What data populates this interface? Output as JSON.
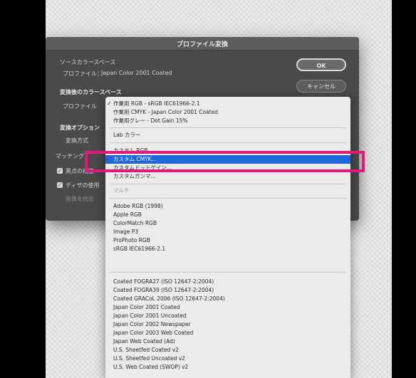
{
  "dialog": {
    "title": "プロファイル変換",
    "source_heading": "ソースカラースペース",
    "source_profile_label": "プロファイル：",
    "source_profile_value": "Japan Color 2001 Coated",
    "dest_heading": "変換後のカラースペース",
    "dest_profile_label": "プロファイル",
    "options_label": "変換オプション",
    "engine_label": "変換方式",
    "matching_label": "マッチング",
    "checkbox1_label": "黒点の補正",
    "checkbox2_label": "ディザの使用",
    "flatten_label": "画像を統合",
    "ok_label": "OK",
    "cancel_label": "キャンセル"
  },
  "dropdown": {
    "top_items": [
      "作業用 RGB - sRGB IEC61966-2.1",
      "作業用 CMYK - Japan Color 2001 Coated",
      "作業用グレー - Dot Gain 15%"
    ],
    "lab_item": "Lab カラー",
    "custom_items": [
      "カスタム RGB...",
      "カスタム CMYK...",
      "カスタムドットゲイン...",
      "カスタムガンマ..."
    ],
    "multichannel_item": "マルチ",
    "rgb_items": [
      "Adobe RGB (1998)",
      "Apple RGB",
      "ColorMatch RGB",
      "Image P3",
      "ProPhoto RGB",
      "sRGB IEC61966-2.1"
    ],
    "cmyk_items": [
      "Coated FOGRA27 (ISO 12647-2:2004)",
      "Coated FOGRA39 (ISO 12647-2:2004)",
      "Coated GRACoL 2006 (ISO 12647-2:2004)",
      "Japan Color 2001 Coated",
      "Japan Color 2001 Uncoated",
      "Japan Color 2002 Newspaper",
      "Japan Color 2003 Web Coated",
      "Japan Web Coated (Ad)",
      "U.S. Sheetfed Coated v2",
      "U.S. Sheetfed Uncoated v2",
      "U.S. Web Coated (SWOP) v2"
    ],
    "selected_item": "作業用 RGB - sRGB IEC61966-2.1",
    "highlighted_item": "カスタム CMYK..."
  },
  "colors": {
    "highlight": "#1d67d6",
    "annotation_border": "#e0197a"
  }
}
